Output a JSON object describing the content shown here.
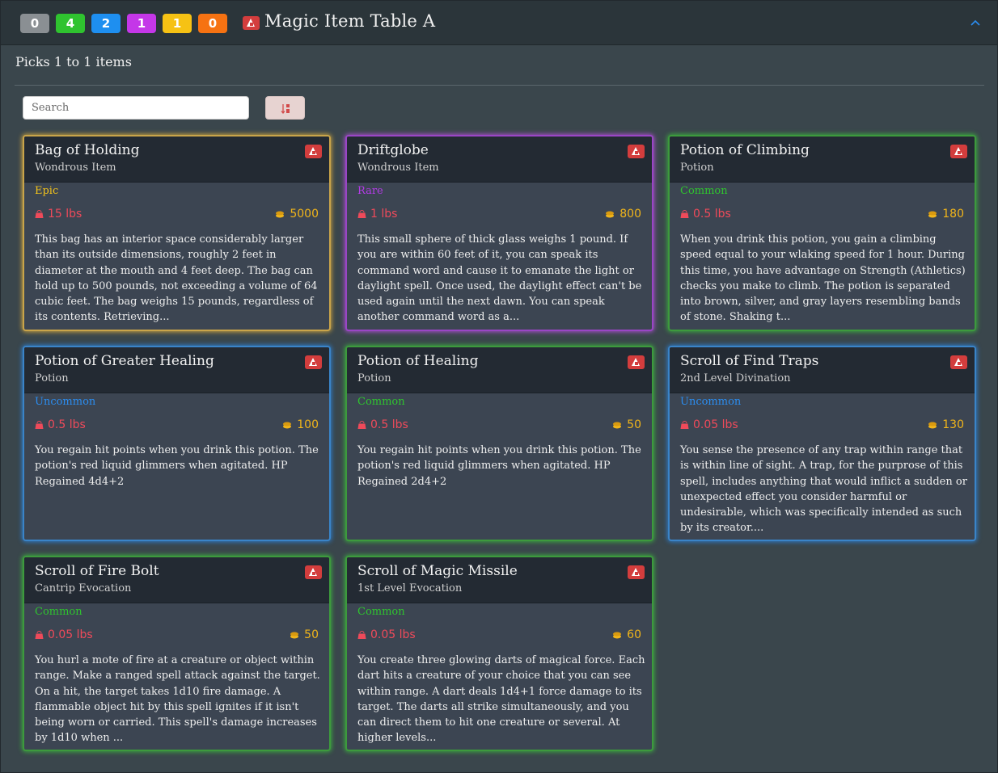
{
  "header": {
    "badges": [
      "0",
      "4",
      "2",
      "1",
      "1",
      "0"
    ],
    "title": "Magic Item Table A",
    "collapse_icon": "chevron-up-icon"
  },
  "picks_text": "Picks 1 to 1 items",
  "search": {
    "placeholder": "Search",
    "value": ""
  },
  "sort_icon": "sort-icon",
  "colors": {
    "epic": "#f2c21b",
    "rare": "#b33be6",
    "common": "#2fc32f",
    "uncommon": "#2b8df0",
    "weight": "#ef4a5a",
    "price": "#f1b51a",
    "source_icon": "#d33d3d"
  },
  "cards": [
    {
      "name": "Bag of Holding",
      "type": "Wondrous Item",
      "rarity": "Epic",
      "weight": "15 lbs",
      "price": "5000",
      "desc": "This bag has an interior space considerably larger than its outside dimensions, roughly 2 feet in diameter at the mouth and 4 feet deep. The bag can hold up to 500 pounds, not exceeding a volume of 64 cubic feet. The bag weighs 15 pounds, regardless of its contents. Retrieving..."
    },
    {
      "name": "Driftglobe",
      "type": "Wondrous Item",
      "rarity": "Rare",
      "weight": "1 lbs",
      "price": "800",
      "desc": "This small sphere of thick glass weighs 1 pound. If you are within 60 feet of it, you can speak its command word and cause it to emanate the light or daylight spell. Once used, the daylight effect can't be used again until the next dawn. You can speak another command word as a..."
    },
    {
      "name": "Potion of Climbing",
      "type": "Potion",
      "rarity": "Common",
      "weight": "0.5 lbs",
      "price": "180",
      "desc": "When you drink this potion, you gain a climbing speed equal to your wlaking speed for 1 hour. During this time, you have advantage on Strength (Athletics) checks you make to climb. The potion is separated into brown, silver, and gray layers resembling bands of stone. Shaking t..."
    },
    {
      "name": "Potion of Greater Healing",
      "type": "Potion",
      "rarity": "Uncommon",
      "weight": "0.5 lbs",
      "price": "100",
      "desc": "You regain hit points when you drink this potion. The potion's red liquid glimmers when agitated. HP Regained 4d4+2"
    },
    {
      "name": "Potion of Healing",
      "type": "Potion",
      "rarity": "Common",
      "weight": "0.5 lbs",
      "price": "50",
      "desc": "You regain hit points when you drink this potion. The potion's red liquid glimmers when agitated. HP Regained 2d4+2"
    },
    {
      "name": "Scroll of Find Traps",
      "type": "2nd Level Divination",
      "rarity": "Uncommon",
      "weight": "0.05 lbs",
      "price": "130",
      "desc": "You sense the presence of any trap within range that is within line of sight. A trap, for the purprose of this spell, includes anything that would inflict a sudden or unexpected effect you consider harmful or undesirable, which was specifically intended as such by its creator...."
    },
    {
      "name": "Scroll of Fire Bolt",
      "type": "Cantrip Evocation",
      "rarity": "Common",
      "weight": "0.05 lbs",
      "price": "50",
      "desc": "You hurl a mote of fire at a creature or object within range. Make a ranged spell attack against the target. On a hit, the target takes 1d10 fire damage. A flammable object hit by this spell ignites if it isn't being worn or carried. This spell's damage increases by 1d10 when ..."
    },
    {
      "name": "Scroll of Magic Missile",
      "type": "1st Level Evocation",
      "rarity": "Common",
      "weight": "0.05 lbs",
      "price": "60",
      "desc": "You create three glowing darts of magical force. Each dart hits a creature of your choice that you can see within range. A dart deals 1d4+1 force damage to its target. The darts all strike simultaneously, and you can direct them to hit one creature or several. At higher levels..."
    }
  ]
}
